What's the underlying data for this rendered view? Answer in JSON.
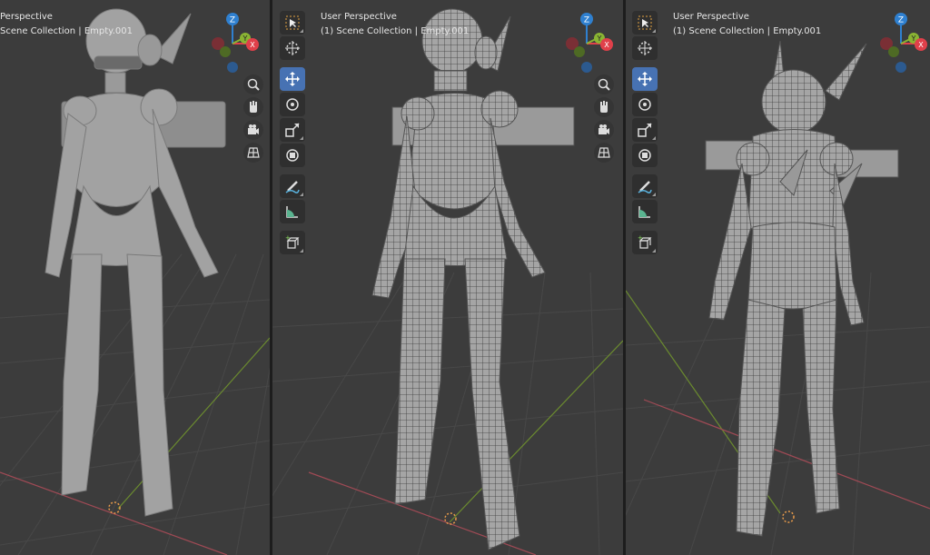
{
  "viewports": [
    {
      "perspective_label": "Perspective",
      "collection_label": "Scene Collection | Empty.001"
    },
    {
      "perspective_label": "User Perspective",
      "collection_label": "(1) Scene Collection | Empty.001"
    },
    {
      "perspective_label": "User Perspective",
      "collection_label": "(1) Scene Collection | Empty.001"
    }
  ],
  "gizmo": {
    "z_label": "Z",
    "y_label": "Y",
    "x_label": "X"
  },
  "colors": {
    "viewport_bg": "#3c3c3c",
    "grid_line": "#4a4a4a",
    "x_axis": "#a04a55",
    "y_axis": "#6b8b2f",
    "tool_active": "#4772b3",
    "gizmo_z": "#2f80d0",
    "gizmo_y": "#8ab433",
    "gizmo_x": "#e0404a"
  },
  "toolbar_tools": [
    "select-box-tool",
    "cursor-tool",
    "move-tool",
    "rotate-tool",
    "scale-tool",
    "transform-tool",
    "annotate-tool",
    "measure-tool",
    "add-cube-tool"
  ],
  "nav_icons": [
    "zoom-icon",
    "hand-pan-icon",
    "camera-icon",
    "grid-view-icon"
  ]
}
